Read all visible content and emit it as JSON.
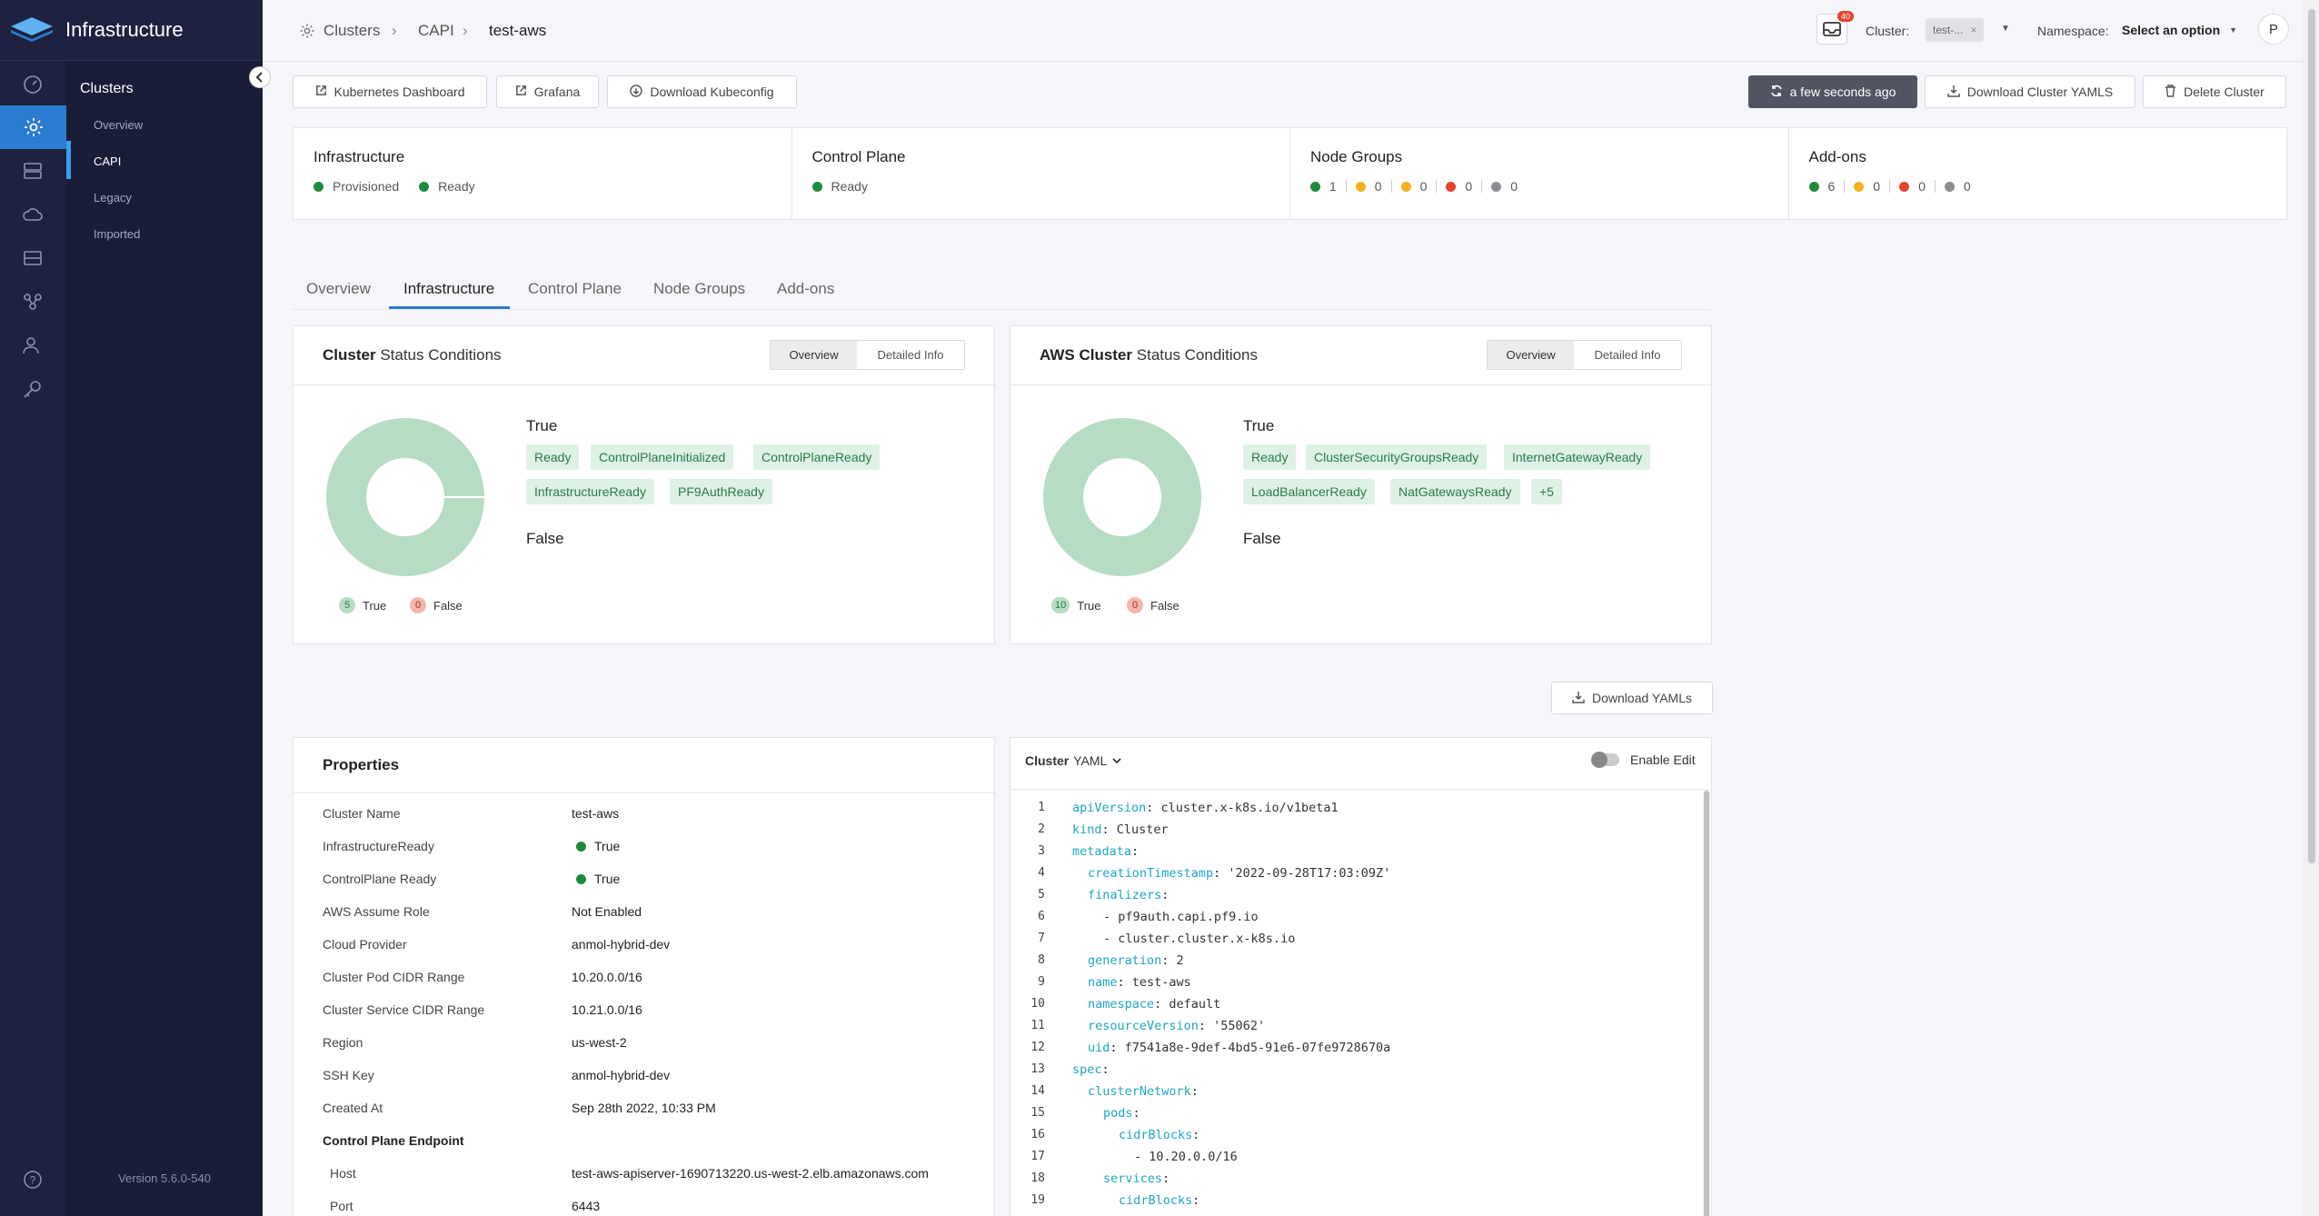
{
  "app": {
    "title": "Infrastructure",
    "version": "Version 5.6.0-540"
  },
  "sidebar": {
    "heading": "Clusters",
    "items": [
      {
        "label": "Overview"
      },
      {
        "label": "CAPI"
      },
      {
        "label": "Legacy"
      },
      {
        "label": "Imported"
      }
    ]
  },
  "header": {
    "breadcrumb": [
      "Clusters",
      "CAPI",
      "test-aws"
    ],
    "notification_count": "40",
    "cluster_label": "Cluster:",
    "cluster_value": "test-...",
    "namespace_label": "Namespace:",
    "namespace_value": "Select an option",
    "avatar": "P"
  },
  "toolbar": {
    "k8s_dashboard": "Kubernetes Dashboard",
    "grafana": "Grafana",
    "download_kubeconfig": "Download Kubeconfig",
    "refresh": "a few seconds ago",
    "download_yamls": "Download Cluster YAMLS",
    "delete_cluster": "Delete Cluster"
  },
  "status_cards": {
    "infrastructure": {
      "title": "Infrastructure",
      "s1": "Provisioned",
      "s2": "Ready"
    },
    "control_plane": {
      "title": "Control Plane",
      "s1": "Ready"
    },
    "node_groups": {
      "title": "Node Groups",
      "counts": [
        "1",
        "0",
        "0",
        "0",
        "0"
      ]
    },
    "addons": {
      "title": "Add-ons",
      "counts": [
        "6",
        "0",
        "0",
        "0"
      ]
    }
  },
  "colors": {
    "green": "#1e8a3e",
    "yellow": "#f2b21b",
    "red": "#e4432c",
    "gray": "#8b8c92",
    "accent": "#2b7bd1",
    "chip_bg": "#def1e5",
    "donut": "#b6dcc3"
  },
  "tabs": [
    "Overview",
    "Infrastructure",
    "Control Plane",
    "Node Groups",
    "Add-ons"
  ],
  "cluster_status": {
    "title_bold": "Cluster",
    "title_rest": "Status Conditions",
    "seg_overview": "Overview",
    "seg_detail": "Detailed Info",
    "true_label": "True",
    "false_label": "False",
    "chips": [
      "Ready",
      "ControlPlaneInitialized",
      "ControlPlaneReady",
      "InfrastructureReady",
      "PF9AuthReady"
    ],
    "legend_true_count": "5",
    "legend_true": "True",
    "legend_false_count": "0",
    "legend_false": "False"
  },
  "aws_status": {
    "title_bold": "AWS Cluster",
    "title_rest": "Status Conditions",
    "seg_overview": "Overview",
    "seg_detail": "Detailed Info",
    "true_label": "True",
    "false_label": "False",
    "chips": [
      "Ready",
      "ClusterSecurityGroupsReady",
      "InternetGatewayReady",
      "LoadBalancerReady",
      "NatGatewaysReady",
      "+5"
    ],
    "legend_true_count": "10",
    "legend_true": "True",
    "legend_false_count": "0",
    "legend_false": "False"
  },
  "download_yamls_button": "Download YAMLs",
  "properties": {
    "title": "Properties",
    "rows": [
      {
        "label": "Cluster Name",
        "value": "test-aws"
      },
      {
        "label": "InfrastructureReady",
        "value": "True"
      },
      {
        "label": "ControlPlane Ready",
        "value": "True"
      },
      {
        "label": "AWS Assume Role",
        "value": "Not Enabled"
      },
      {
        "label": "Cloud Provider",
        "value": "anmol-hybrid-dev"
      },
      {
        "label": "Cluster Pod CIDR Range",
        "value": "10.20.0.0/16"
      },
      {
        "label": "Cluster Service CIDR Range",
        "value": "10.21.0.0/16"
      },
      {
        "label": "Region",
        "value": "us-west-2"
      },
      {
        "label": "SSH Key",
        "value": "anmol-hybrid-dev"
      },
      {
        "label": "Created At",
        "value": "Sep 28th 2022, 10:33 PM"
      }
    ],
    "endpoint_heading": "Control Plane Endpoint",
    "endpoint_rows": [
      {
        "label": "Host",
        "value": "test-aws-apiserver-1690713220.us-west-2.elb.amazonaws.com"
      },
      {
        "label": "Port",
        "value": "6443"
      }
    ]
  },
  "yaml": {
    "title_bold": "Cluster",
    "title_rest": "YAML",
    "enable_edit": "Enable Edit",
    "lines": [
      {
        "n": "1",
        "k": "apiVersion",
        "v": ": cluster.x-k8s.io/v1beta1",
        "i": 0
      },
      {
        "n": "2",
        "k": "kind",
        "v": ": Cluster",
        "i": 0
      },
      {
        "n": "3",
        "k": "metadata",
        "v": ":",
        "i": 0
      },
      {
        "n": "4",
        "k": "creationTimestamp",
        "v": ": '2022-09-28T17:03:09Z'",
        "i": 1
      },
      {
        "n": "5",
        "k": "finalizers",
        "v": ":",
        "i": 1
      },
      {
        "n": "6",
        "k": "",
        "v": "- pf9auth.capi.pf9.io",
        "i": 2
      },
      {
        "n": "7",
        "k": "",
        "v": "- cluster.cluster.x-k8s.io",
        "i": 2
      },
      {
        "n": "8",
        "k": "generation",
        "v": ": 2",
        "i": 1
      },
      {
        "n": "9",
        "k": "name",
        "v": ": test-aws",
        "i": 1
      },
      {
        "n": "10",
        "k": "namespace",
        "v": ": default",
        "i": 1
      },
      {
        "n": "11",
        "k": "resourceVersion",
        "v": ": '55062'",
        "i": 1
      },
      {
        "n": "12",
        "k": "uid",
        "v": ": f7541a8e-9def-4bd5-91e6-07fe9728670a",
        "i": 1
      },
      {
        "n": "13",
        "k": "spec",
        "v": ":",
        "i": 0
      },
      {
        "n": "14",
        "k": "clusterNetwork",
        "v": ":",
        "i": 1
      },
      {
        "n": "15",
        "k": "pods",
        "v": ":",
        "i": 2
      },
      {
        "n": "16",
        "k": "cidrBlocks",
        "v": ":",
        "i": 3
      },
      {
        "n": "17",
        "k": "",
        "v": "- 10.20.0.0/16",
        "i": 4
      },
      {
        "n": "18",
        "k": "services",
        "v": ":",
        "i": 2
      },
      {
        "n": "19",
        "k": "cidrBlocks",
        "v": ":",
        "i": 3
      }
    ]
  }
}
